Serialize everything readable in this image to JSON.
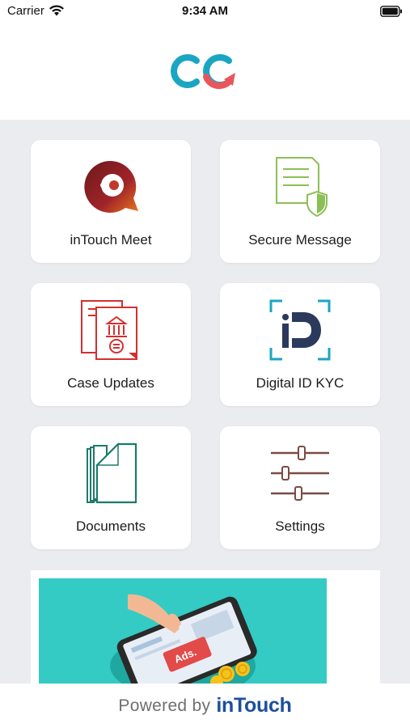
{
  "status_bar": {
    "carrier": "Carrier",
    "time": "9:34 AM"
  },
  "header": {
    "logo": "intouch-logo-icon"
  },
  "tiles": [
    {
      "label": "inTouch Meet",
      "icon": "chat-bubble-icon"
    },
    {
      "label": "Secure Message",
      "icon": "secure-document-icon"
    },
    {
      "label": "Case Updates",
      "icon": "case-document-icon"
    },
    {
      "label": "Digital ID KYC",
      "icon": "digital-id-icon"
    },
    {
      "label": "Documents",
      "icon": "folder-icon"
    },
    {
      "label": "Settings",
      "icon": "sliders-icon"
    }
  ],
  "ad": {
    "text": "Ads."
  },
  "footer": {
    "powered_by": "Powered by",
    "brand": "inTouch"
  },
  "colors": {
    "teal": "#1aa6c2",
    "coral": "#e8565b",
    "brand_blue": "#1c4f9c",
    "green": "#8cbf55",
    "red": "#d4302f",
    "navy": "#2b3a5c",
    "brown": "#7a4b43",
    "folder_teal": "#1d7a6b"
  }
}
